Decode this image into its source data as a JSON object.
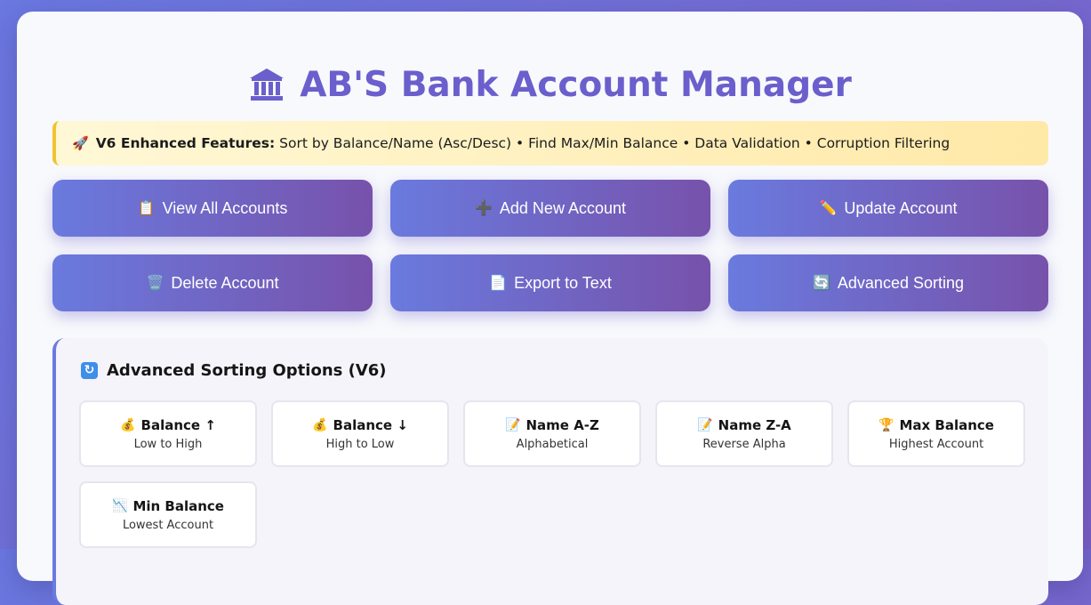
{
  "header": {
    "title": "AB'S Bank Account Manager",
    "icon": "bank-icon"
  },
  "banner": {
    "icon": "rocket-icon",
    "lead": "V6 Enhanced Features:",
    "text": "Sort by Balance/Name (Asc/Desc) • Find Max/Min Balance • Data Validation • Corruption Filtering"
  },
  "actions": [
    {
      "label": "View All Accounts",
      "icon": "clipboard-icon",
      "glyph": "📋"
    },
    {
      "label": "Add New Account",
      "icon": "plus-icon",
      "glyph": "➕"
    },
    {
      "label": "Update Account",
      "icon": "pencil-icon",
      "glyph": "✏️"
    },
    {
      "label": "Delete Account",
      "icon": "trash-icon",
      "glyph": "🗑️"
    },
    {
      "label": "Export to Text",
      "icon": "document-icon",
      "glyph": "📄"
    },
    {
      "label": "Advanced Sorting",
      "icon": "refresh-icon",
      "glyph": "🔄"
    }
  ],
  "sorting": {
    "title": "Advanced Sorting Options (V6)",
    "options": [
      {
        "title": "Balance ↑",
        "subtitle": "Low to High",
        "icon": "money-bag-icon",
        "glyph": "💰"
      },
      {
        "title": "Balance ↓",
        "subtitle": "High to Low",
        "icon": "money-bag-icon",
        "glyph": "💰"
      },
      {
        "title": "Name A-Z",
        "subtitle": "Alphabetical",
        "icon": "memo-icon",
        "glyph": "📝"
      },
      {
        "title": "Name Z-A",
        "subtitle": "Reverse Alpha",
        "icon": "memo-icon",
        "glyph": "📝"
      },
      {
        "title": "Max Balance",
        "subtitle": "Highest Account",
        "icon": "trophy-icon",
        "glyph": "🏆"
      },
      {
        "title": "Min Balance",
        "subtitle": "Lowest Account",
        "icon": "chart-decreasing-icon",
        "glyph": "📉"
      }
    ]
  },
  "colors": {
    "accent": "#6a5fcc",
    "button_start": "#6a7ade",
    "button_end": "#7752ab",
    "banner_border": "#f2c230"
  }
}
